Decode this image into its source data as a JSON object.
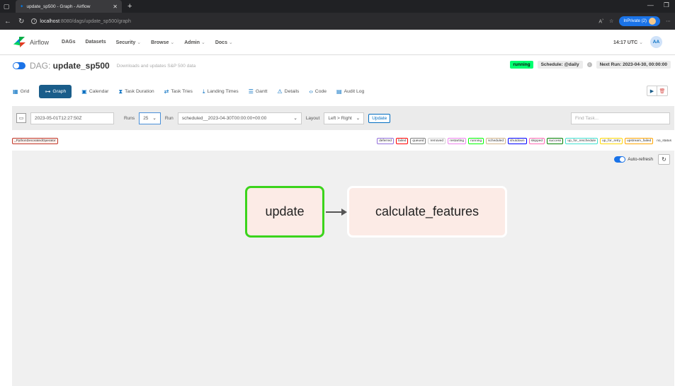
{
  "browser": {
    "tab_title": "update_sp500 - Graph - Airflow",
    "url_host": "localhost",
    "url_rest": ":8080/dags/update_sp500/graph",
    "inprivate_label": "InPrivate (2)"
  },
  "navbar": {
    "brand": "Airflow",
    "menu": [
      {
        "label": "DAGs"
      },
      {
        "label": "Datasets"
      },
      {
        "label": "Security"
      },
      {
        "label": "Browse"
      },
      {
        "label": "Admin"
      },
      {
        "label": "Docs"
      }
    ],
    "time": "14:17 UTC",
    "avatar_initials": "AA"
  },
  "dag": {
    "prefix": "DAG: ",
    "dag_id": "update_sp500",
    "description": "Downloads and updates S&P 500 data",
    "state": "running",
    "schedule": "Schedule: @daily",
    "next_run": "Next Run: 2023-04-30, 00:00:00"
  },
  "views": [
    {
      "label": "Grid",
      "icon": "grid-icon"
    },
    {
      "label": "Graph",
      "icon": "graph-icon"
    },
    {
      "label": "Calendar",
      "icon": "calendar-icon"
    },
    {
      "label": "Task Duration",
      "icon": "hourglass-icon"
    },
    {
      "label": "Task Tries",
      "icon": "tries-icon"
    },
    {
      "label": "Landing Times",
      "icon": "landing-icon"
    },
    {
      "label": "Gantt",
      "icon": "gantt-icon"
    },
    {
      "label": "Details",
      "icon": "details-icon"
    },
    {
      "label": "Code",
      "icon": "code-icon"
    },
    {
      "label": "Audit Log",
      "icon": "audit-icon"
    }
  ],
  "filters": {
    "base_date": "2023-05-01T12:27:50Z",
    "runs_label": "Runs",
    "runs_value": "25",
    "run_label": "Run",
    "run_value": "scheduled__2023-04-30T00:00:00+00:00",
    "layout_label": "Layout",
    "layout_value": "Left > Right",
    "update_label": "Update",
    "find_placeholder": "Find Task..."
  },
  "operator_tag": "_PythonDecoratedOperator",
  "legend": [
    {
      "label": "deferred",
      "color": "#9370db"
    },
    {
      "label": "failed",
      "color": "#ff0000"
    },
    {
      "label": "queued",
      "color": "#808080"
    },
    {
      "label": "removed",
      "color": "#d3d3d3"
    },
    {
      "label": "restarting",
      "color": "#ee82ee"
    },
    {
      "label": "running",
      "color": "#00ff00"
    },
    {
      "label": "scheduled",
      "color": "#d2b48c"
    },
    {
      "label": "shutdown",
      "color": "#0000ff"
    },
    {
      "label": "skipped",
      "color": "#ff69b4"
    },
    {
      "label": "success",
      "color": "#008000"
    },
    {
      "label": "up_for_reschedule",
      "color": "#40e0d0"
    },
    {
      "label": "up_for_retry",
      "color": "#ffd700"
    },
    {
      "label": "upstream_failed",
      "color": "#ffa500"
    },
    {
      "label": "no_status",
      "color": "#ffffff"
    }
  ],
  "graph": {
    "auto_refresh_label": "Auto-refresh",
    "nodes": [
      {
        "id": "update",
        "label": "update",
        "border_color": "#3bd41c"
      },
      {
        "id": "calculate_features",
        "label": "calculate_features",
        "border_color": "#ffffff"
      }
    ]
  }
}
